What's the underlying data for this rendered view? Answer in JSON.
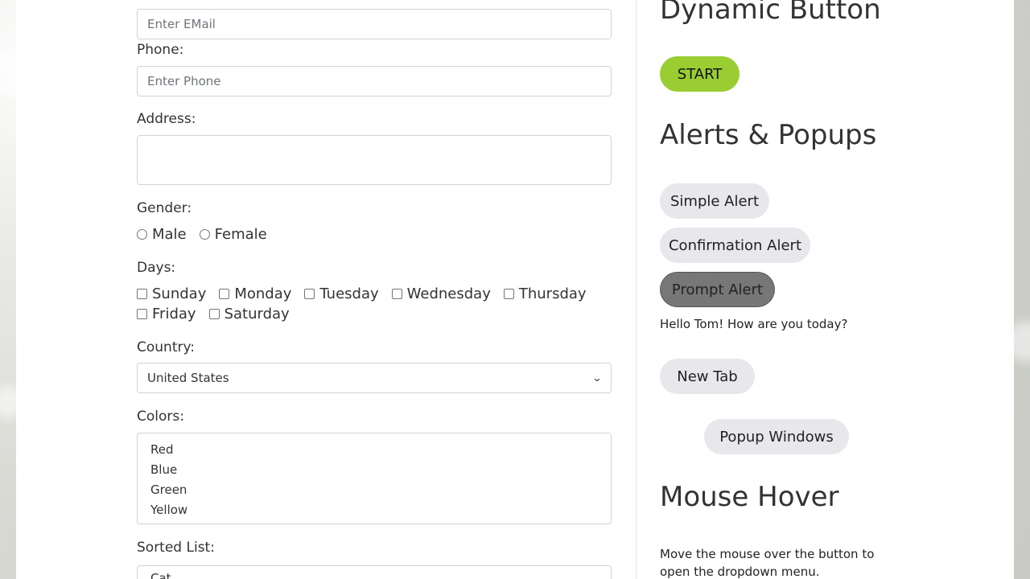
{
  "form": {
    "email_placeholder": "Enter EMail",
    "phone_label": "Phone:",
    "phone_placeholder": "Enter Phone",
    "address_label": "Address:",
    "gender_label": "Gender:",
    "gender_options": [
      "Male",
      "Female"
    ],
    "days_label": "Days:",
    "days": [
      "Sunday",
      "Monday",
      "Tuesday",
      "Wednesday",
      "Thursday",
      "Friday",
      "Saturday"
    ],
    "country_label": "Country:",
    "country_value": "United States",
    "colors_label": "Colors:",
    "colors": [
      "Red",
      "Blue",
      "Green",
      "Yellow"
    ],
    "sorted_label": "Sorted List:",
    "sorted_first": "Cat"
  },
  "sidebar": {
    "dynamic_title": "Dynamic Button",
    "start_label": "START",
    "alerts_title": "Alerts & Popups",
    "simple_alert": "Simple Alert",
    "confirmation_alert": "Confirmation Alert",
    "prompt_alert": "Prompt Alert",
    "prompt_result": "Hello Tom! How are you today?",
    "new_tab": "New Tab",
    "popup_windows": "Popup Windows",
    "hover_title": "Mouse Hover",
    "hover_text_1": "Move the mouse over the button to",
    "hover_text_2": "open the dropdown menu."
  },
  "colors": {
    "start_button": "#9acd32",
    "pill_button": "#e7e7ec",
    "pressed_button": "#777777"
  }
}
